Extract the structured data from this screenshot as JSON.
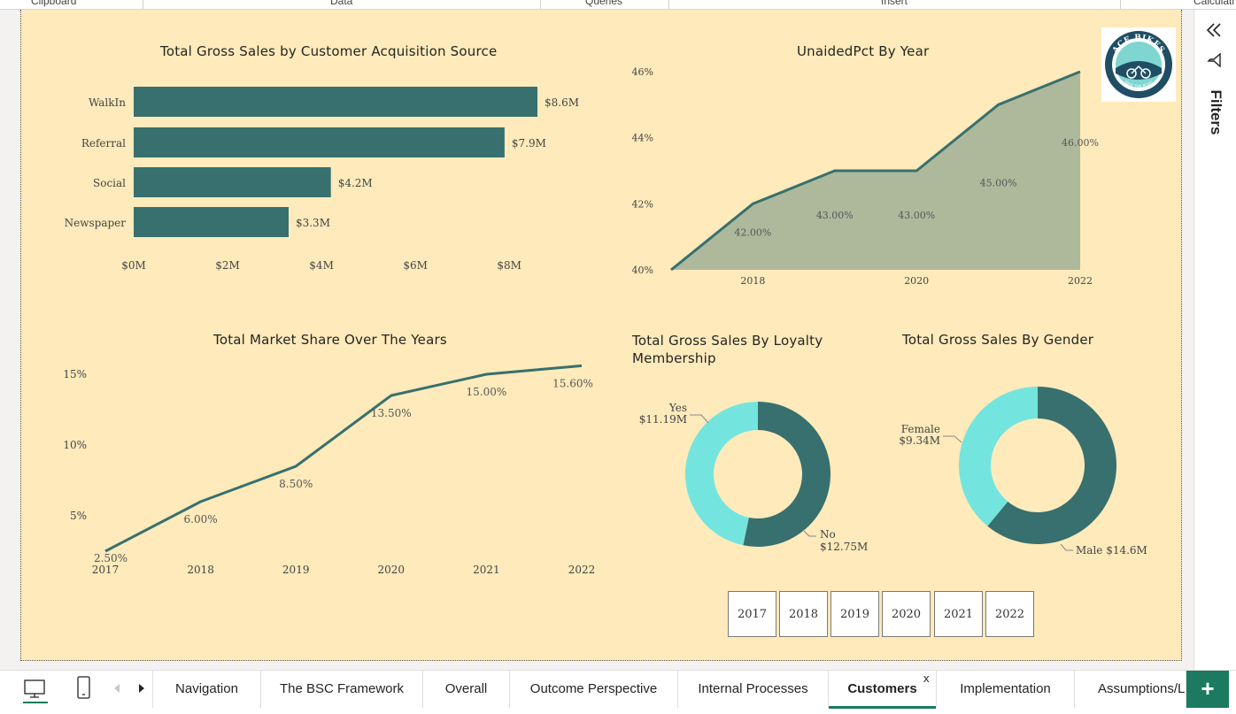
{
  "ribbon": {
    "groups": [
      "Clipboard",
      "Data",
      "Queries",
      "Insert",
      "Calculati"
    ]
  },
  "right_pane": {
    "collapse_icon": "double-chevron-left-icon",
    "filter_icon": "funnel-icon",
    "filters_label": "Filters"
  },
  "logo": {
    "text_top": "ACE BIKES",
    "text_bottom": "RIDE THE ROAD"
  },
  "colors": {
    "canvas": "#feeabb",
    "teal_dark": "#37706e",
    "teal_light": "#74e5de",
    "area_fill": "#aeb99c",
    "active_tab_underline": "#1b7a5f",
    "add_button": "#1b7a5f"
  },
  "charts": {
    "acquisition": {
      "title": "Total Gross Sales by Customer Acquisition Source",
      "chart_data": {
        "type": "bar",
        "orientation": "horizontal",
        "categories": [
          "WalkIn",
          "Referral",
          "Social",
          "Newspaper"
        ],
        "values": [
          8.6,
          7.9,
          4.2,
          3.3
        ],
        "data_labels": [
          "$8.6M",
          "$7.9M",
          "$4.2M",
          "$3.3M"
        ],
        "x_ticks": [
          "$0M",
          "$2M",
          "$4M",
          "$6M",
          "$8M"
        ],
        "xlim": [
          0,
          8.6
        ],
        "unit": "$M",
        "color": "#37706e"
      }
    },
    "unaided": {
      "title": "UnaidedPct By Year",
      "chart_data": {
        "type": "area",
        "x": [
          2017,
          2018,
          2019,
          2020,
          2021,
          2022
        ],
        "values": [
          40.0,
          42.0,
          43.0,
          43.0,
          45.0,
          46.0
        ],
        "data_labels": [
          "",
          "42.00%",
          "43.00%",
          "43.00%",
          "45.00%",
          "46.00%"
        ],
        "y_ticks": [
          "40%",
          "42%",
          "44%",
          "46%"
        ],
        "ylim": [
          40,
          46
        ],
        "x_ticks": [
          "2018",
          "2020",
          "2022"
        ],
        "line_color": "#37706e",
        "fill_color": "#aeb99c"
      }
    },
    "market_share": {
      "title": "Total Market Share Over The Years",
      "chart_data": {
        "type": "line",
        "x": [
          2017,
          2018,
          2019,
          2020,
          2021,
          2022
        ],
        "values": [
          2.5,
          6.0,
          8.5,
          13.5,
          15.0,
          15.6
        ],
        "data_labels": [
          "2.50%",
          "6.00%",
          "8.50%",
          "13.50%",
          "15.00%",
          "15.60%"
        ],
        "y_ticks": [
          "5%",
          "10%",
          "15%"
        ],
        "ylim": [
          0,
          16
        ],
        "x_ticks": [
          "2017",
          "2018",
          "2019",
          "2020",
          "2021",
          "2022"
        ],
        "color": "#37706e"
      }
    },
    "loyalty": {
      "title": "Total Gross Sales By Loyalty Membership",
      "chart_data": {
        "type": "pie",
        "donut": true,
        "categories": [
          "Yes",
          "No"
        ],
        "values": [
          11.19,
          12.75
        ],
        "data_labels": [
          "$11.19M",
          "$12.75M"
        ],
        "unit": "$M",
        "colors": [
          "#74e5de",
          "#37706e"
        ]
      }
    },
    "gender": {
      "title": "Total Gross Sales By Gender",
      "chart_data": {
        "type": "pie",
        "donut": true,
        "categories": [
          "Female",
          "Male"
        ],
        "values": [
          9.34,
          14.6
        ],
        "data_labels": [
          "$9.34M",
          "$14.6M"
        ],
        "unit": "$M",
        "colors": [
          "#74e5de",
          "#37706e"
        ]
      }
    }
  },
  "year_slicer": {
    "options": [
      "2017",
      "2018",
      "2019",
      "2020",
      "2021",
      "2022"
    ]
  },
  "tabbar": {
    "desktop_icon": "monitor-icon",
    "phone_icon": "phone-icon",
    "prev_icon": "triangle-left-icon",
    "next_icon": "triangle-right-icon",
    "tabs": [
      "Navigation",
      "The BSC Framework",
      "Overall",
      "Outcome Perspective",
      "Internal Processes",
      "Customers",
      "Implementation",
      "Assumptions/L"
    ],
    "active_tab": "Customers",
    "close_glyph": "x",
    "add_glyph": "+"
  }
}
